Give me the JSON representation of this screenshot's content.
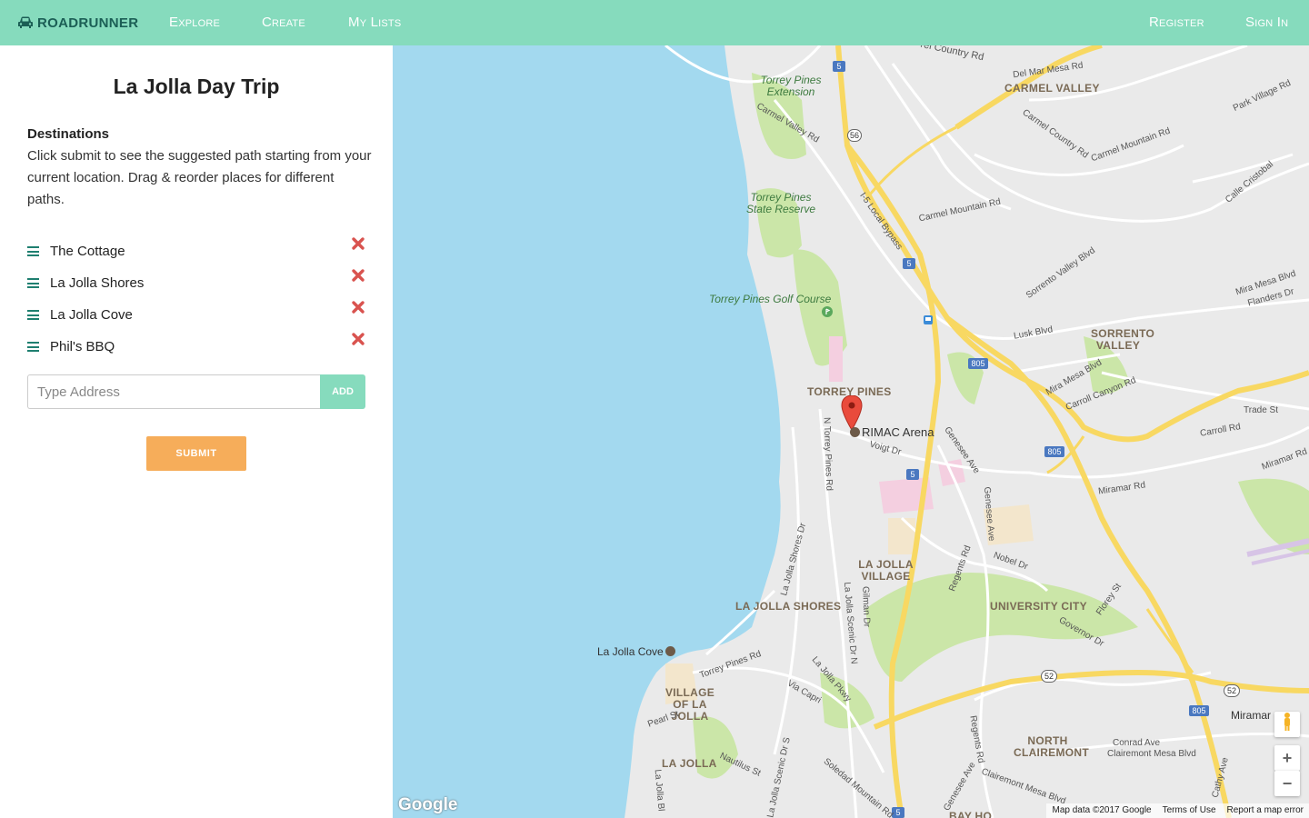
{
  "app": {
    "brand": "RoadRunner"
  },
  "nav": {
    "explore": "Explore",
    "create": "Create",
    "my_lists": "My Lists",
    "register": "Register",
    "sign_in": "Sign In"
  },
  "trip": {
    "title": "La Jolla Day Trip",
    "destinations_heading": "Destinations",
    "description": "Click submit to see the suggested path starting from your current location. Drag & reorder places for different paths.",
    "items": [
      {
        "label": "The Cottage"
      },
      {
        "label": "La Jolla Shores"
      },
      {
        "label": "La Jolla Cove"
      },
      {
        "label": "Phil's BBQ"
      }
    ],
    "address_placeholder": "Type Address",
    "add_label": "ADD",
    "submit_label": "SUBMIT"
  },
  "colors": {
    "accent": "#86dbbd",
    "brand_text": "#1b5e55",
    "submit": "#f6ad5a",
    "delete": "#d9534f",
    "water": "#a3d9ef",
    "freeway": "#f8d862"
  },
  "map": {
    "places": {
      "carmel_valley": "CARMEL VALLEY",
      "sorrento_valley": "SORRENTO VALLEY",
      "torrey_pines": "TORREY PINES",
      "la_jolla_village": "LA JOLLA VILLAGE",
      "la_jolla_shores": "LA JOLLA SHORES",
      "university_city": "UNIVERSITY CITY",
      "village_of_la_jolla": "VILLAGE OF LA JOLLA",
      "north_clairemont": "NORTH CLAIREMONT",
      "la_jolla": "LA JOLLA"
    },
    "parks": {
      "extension": "Torrey Pines Extension",
      "reserve": "Torrey Pines State Reserve",
      "golf": "Torrey Pines Golf Course"
    },
    "pois": {
      "rimac": "RIMAC Arena",
      "cove": "La Jolla Cove",
      "miramar": "Miramar"
    },
    "roads": {
      "country_rd": "rel Country Rd",
      "del_mar_mesa": "Del Mar Mesa Rd",
      "park_village": "Park Village Rd",
      "carmel_country": "Carmel Country Rd",
      "carmel_mountain": "Carmel Mountain Rd",
      "carmel_mountain2": "Carmel Mountain Rd",
      "calle_cristobal": "Calle Cristobal",
      "carmel_valley_rd": "Carmel Valley Rd",
      "bypass": "I-5 Local Bypass",
      "sorrento_valley_blvd": "Sorrento Valley Blvd",
      "mira_mesa_blvd": "Mira Mesa Blvd",
      "flanders": "Flanders Dr",
      "lusk": "Lusk Blvd",
      "mira_mesa2": "Mira Mesa Blvd",
      "carroll_canyon": "Carroll Canyon Rd",
      "trade": "Trade St",
      "carroll_rd": "Carroll Rd",
      "miramar_rd": "Miramar Rd",
      "miramar_rd2": "Miramar Rd",
      "voigt": "Voigt Dr",
      "genesee": "Genesee Ave",
      "genesee2": "Genesee Ave",
      "n_torrey": "N Torrey Pines Rd",
      "nobel": "Nobel Dr",
      "regents": "Regents Rd",
      "torrey_shores": "Torrey Pines Rd",
      "lj_shores_dr": "La Jolla Shores Dr",
      "lj_scenic_n": "La Jolla Scenic Dr N",
      "gilman": "Gilman Dr",
      "florey": "Florey St",
      "governor": "Governor Dr",
      "torrey_pines_rd2": "Torrey Pines Rd",
      "via_capri": "Via Capri",
      "lj_pkwy": "La Jolla Pkwy",
      "pearl": "Pearl St",
      "nautilus": "Nautilus St",
      "lj_scenic_s": "La Jolla Scenic Dr S",
      "soledad": "Soledad Mountain Rd",
      "regents2": "Regents Rd",
      "conrad": "Conrad Ave",
      "clairemont_mesa": "Clairemont Mesa Blvd",
      "clairemont_mesa2": "Clairemont Mesa Blvd",
      "cathy": "Cathy Ave",
      "lj_blvd": "La Jolla Bl",
      "genesee3": "Genesee Ave",
      "bay_ho": "BAY HO"
    },
    "shields": [
      "5",
      "56",
      "5",
      "805",
      "805",
      "5",
      "52",
      "805",
      "52",
      "5"
    ],
    "footer": {
      "data": "Map data ©2017 Google",
      "terms": "Terms of Use",
      "report": "Report a map error"
    },
    "google": "Google"
  }
}
